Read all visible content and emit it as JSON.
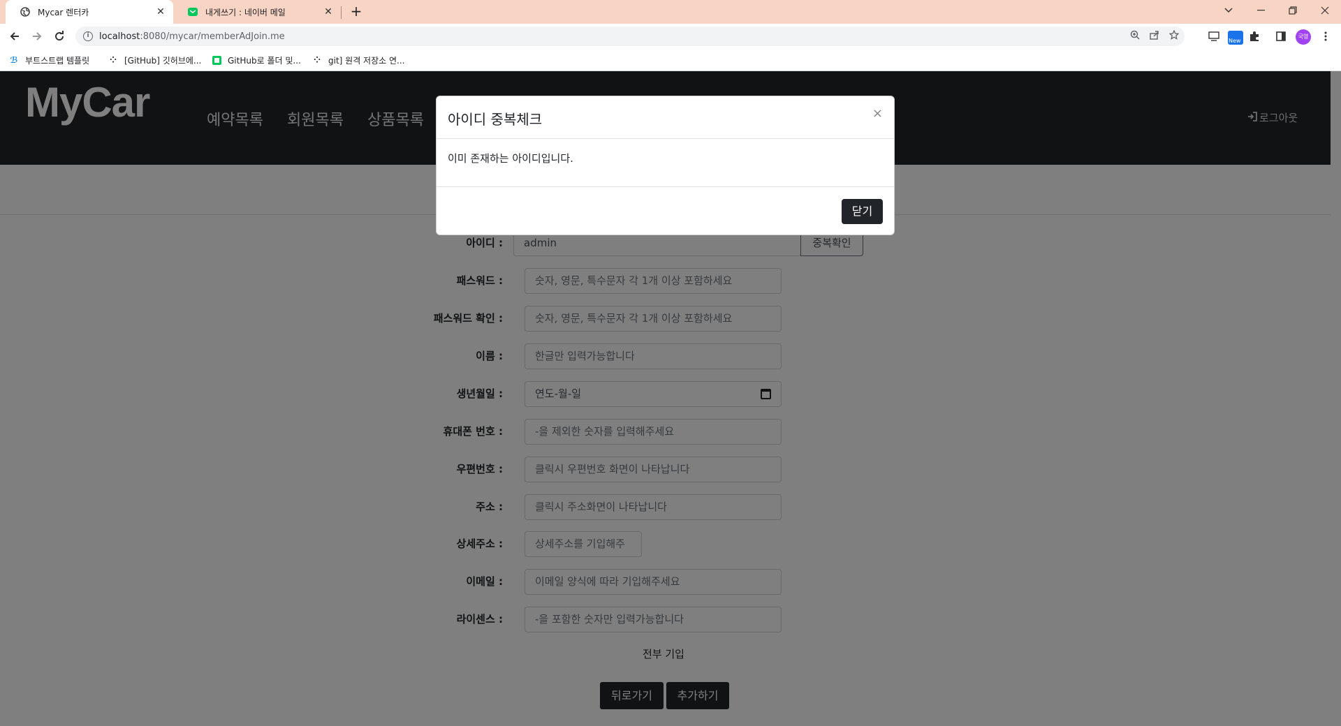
{
  "browser": {
    "tabs": [
      {
        "title": "Mycar 렌터카",
        "active": true
      },
      {
        "title": "내게쓰기 : 네이버 메일",
        "active": false
      }
    ],
    "url_host": "localhost",
    "url_rest": ":8080/mycar/memberAdJoin.me",
    "bookmarks": [
      "부트스트랩 템플릿",
      "[GitHub] 깃허브에...",
      "GitHub로 폴더 및...",
      "git] 원격 저장소 연..."
    ],
    "new_badge": "New",
    "avatar_text": "국영"
  },
  "site": {
    "brand": "MyCar",
    "nav": [
      "예약목록",
      "회원목록",
      "상품목록"
    ],
    "logout": "로그아웃"
  },
  "form": {
    "id_label": "아이디 :",
    "id_value": "admin",
    "check_button": "중복확인",
    "fields": [
      {
        "label": "패스워드 :",
        "placeholder": "숫자, 영문, 특수문자 각 1개 이상 포함하세요"
      },
      {
        "label": "패스워드 확인 :",
        "placeholder": "숫자, 영문, 특수문자 각 1개 이상 포함하세요"
      },
      {
        "label": "이름 :",
        "placeholder": "한글만 입력가능합니다"
      },
      {
        "label": "생년월일 :",
        "placeholder": "연도-월-일"
      },
      {
        "label": "휴대폰 번호 :",
        "placeholder": "-을 제외한 숫자를 입력해주세요"
      },
      {
        "label": "우편번호 :",
        "placeholder": "클릭시 우편번호 화면이 나타납니다"
      },
      {
        "label": "주소 :",
        "placeholder": "클릭시 주소화면이 나타납니다"
      },
      {
        "label": "상세주소 :",
        "placeholder": "상세주소를 기입해주"
      },
      {
        "label": "이메일 :",
        "placeholder": "이메일 양식에 따라 기입해주세요"
      },
      {
        "label": "라이센스 :",
        "placeholder": "-을 포함한 숫자만 입력가능합니다"
      }
    ],
    "fill_all": "전부 기입",
    "back_button": "뒤로가기",
    "add_button": "추가하기"
  },
  "modal": {
    "title": "아이디 중복체크",
    "close_symbol": "×",
    "message": "이미 존재하는 아이디입니다.",
    "close_button": "닫기"
  }
}
